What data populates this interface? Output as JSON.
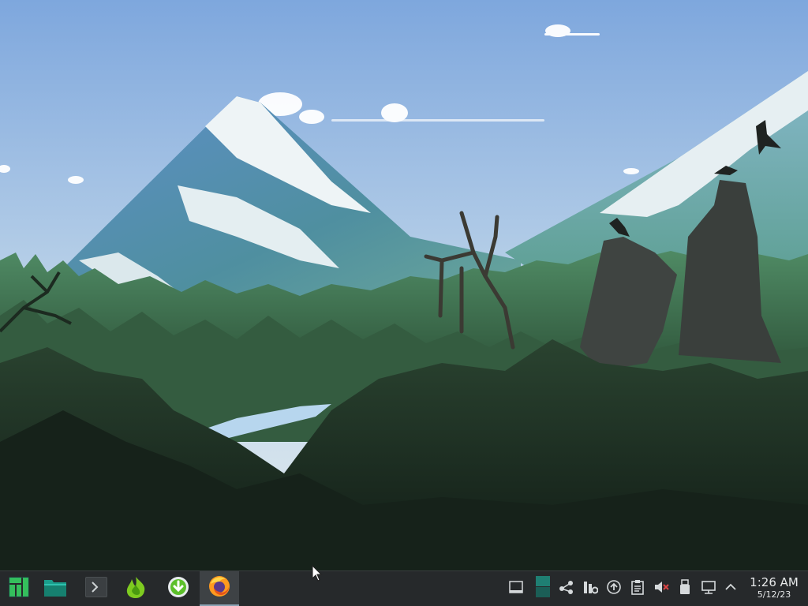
{
  "desktop": {
    "wallpaper": "mountain-forest-landscape",
    "colors": {
      "sky_top": "#86aee0",
      "sky_bottom": "#dfe9ef",
      "forest": "#2b4a33",
      "ground": "#1d2d22"
    }
  },
  "taskbar": {
    "background": "#26292b",
    "launchers": [
      {
        "name": "application-menu",
        "icon": "manjaro-logo-icon"
      },
      {
        "name": "file-manager",
        "icon": "folder-icon"
      },
      {
        "name": "terminal",
        "icon": "terminal-icon"
      },
      {
        "name": "app-launcher-green",
        "icon": "green-flame-icon"
      },
      {
        "name": "software-updater",
        "icon": "download-arrow-icon"
      },
      {
        "name": "firefox",
        "icon": "firefox-icon",
        "active": true
      }
    ],
    "tray": [
      {
        "name": "show-desktop",
        "icon": "window-icon"
      },
      {
        "name": "pager",
        "icon": "virtual-desktop-icon"
      },
      {
        "name": "kde-connect",
        "icon": "share-icon"
      },
      {
        "name": "system-monitor",
        "icon": "monitor-settings-icon"
      },
      {
        "name": "updates",
        "icon": "update-arrow-icon"
      },
      {
        "name": "clipboard",
        "icon": "clipboard-icon"
      },
      {
        "name": "volume",
        "icon": "volume-muted-icon"
      },
      {
        "name": "removable-devices",
        "icon": "usb-icon"
      },
      {
        "name": "network",
        "icon": "network-wired-icon"
      },
      {
        "name": "expand-tray",
        "icon": "chevron-up-icon"
      }
    ],
    "clock": {
      "time": "1:26 AM",
      "date": "5/12/23"
    }
  }
}
